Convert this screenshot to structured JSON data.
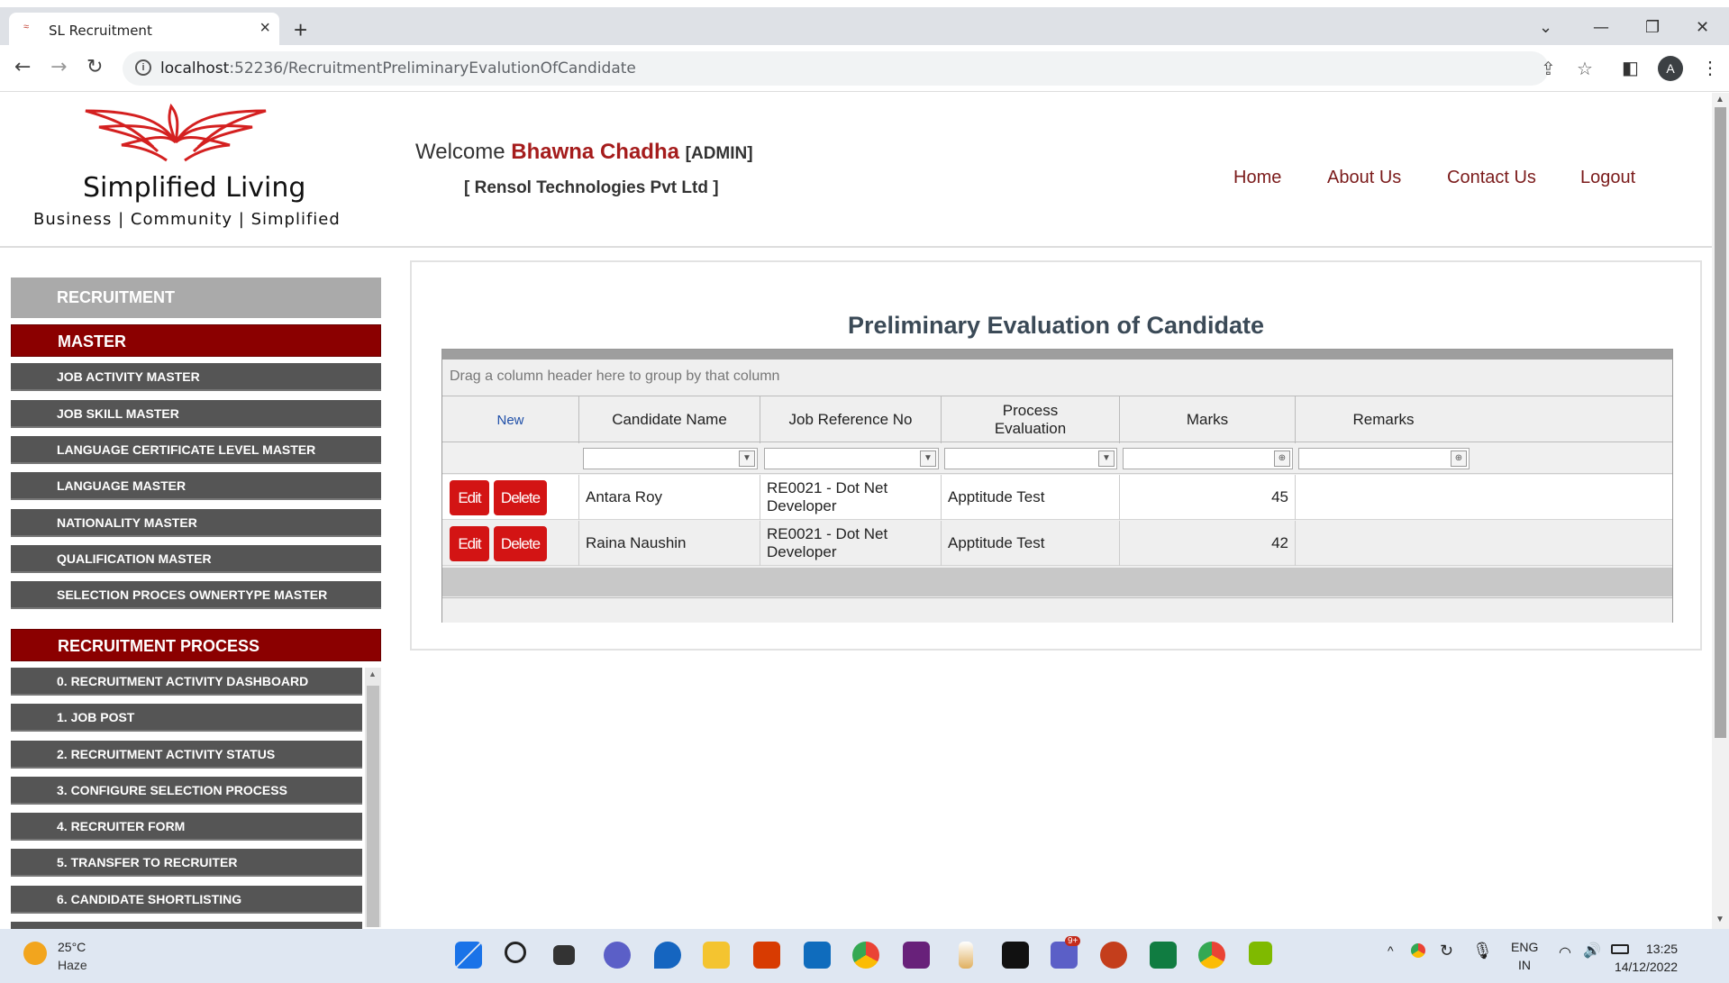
{
  "browser": {
    "tab_title": "SL Recruitment",
    "url_host": "localhost",
    "url_rest": ":52236/RecruitmentPreliminaryEvalutionOfCandidate",
    "avatar_letter": "A"
  },
  "header": {
    "logo_name": "Simplified Living",
    "logo_tagline": "Business | Community | Simplified",
    "welcome_prefix": "Welcome",
    "user_name": "Bhawna Chadha",
    "role": "[ADMIN]",
    "company": "[ Rensol Technologies Pvt Ltd ]",
    "nav": [
      "Home",
      "About Us",
      "Contact Us",
      "Logout"
    ]
  },
  "sidebar": {
    "section_recruitment": "RECRUITMENT",
    "section_master": "MASTER",
    "master_items": [
      "JOB ACTIVITY MASTER",
      "JOB SKILL MASTER",
      "LANGUAGE CERTIFICATE LEVEL MASTER",
      "LANGUAGE MASTER",
      "NATIONALITY MASTER",
      "QUALIFICATION MASTER",
      "SELECTION PROCES OWNERTYPE MASTER"
    ],
    "section_process": "RECRUITMENT PROCESS",
    "process_items": [
      "0. RECRUITMENT ACTIVITY DASHBOARD",
      "1. JOB POST",
      "2. RECRUITMENT ACTIVITY STATUS",
      "3. CONFIGURE SELECTION PROCESS",
      "4. RECRUITER FORM",
      "5. TRANSFER TO RECRUITER",
      "6. CANDIDATE SHORTLISTING"
    ]
  },
  "main": {
    "title": "Preliminary Evaluation of Candidate",
    "group_panel_text": "Drag a column header here to group by that column",
    "new_label": "New",
    "columns": [
      "Candidate Name",
      "Job Reference No",
      "Process Evaluation",
      "Marks",
      "Remarks"
    ],
    "edit_label": "Edit",
    "delete_label": "Delete",
    "rows": [
      {
        "candidate": "Antara Roy",
        "job_ref": "RE0021 - Dot Net Developer",
        "process": "Apptitude Test",
        "marks": "45",
        "remarks": ""
      },
      {
        "candidate": "Raina Naushin",
        "job_ref": "RE0021 - Dot Net Developer",
        "process": "Apptitude Test",
        "marks": "42",
        "remarks": ""
      }
    ]
  },
  "taskbar": {
    "temperature": "25°C",
    "weather": "Haze",
    "lang_top": "ENG",
    "lang_bottom": "IN",
    "time": "13:25",
    "date": "14/12/2022",
    "teams_badge": "9+"
  }
}
